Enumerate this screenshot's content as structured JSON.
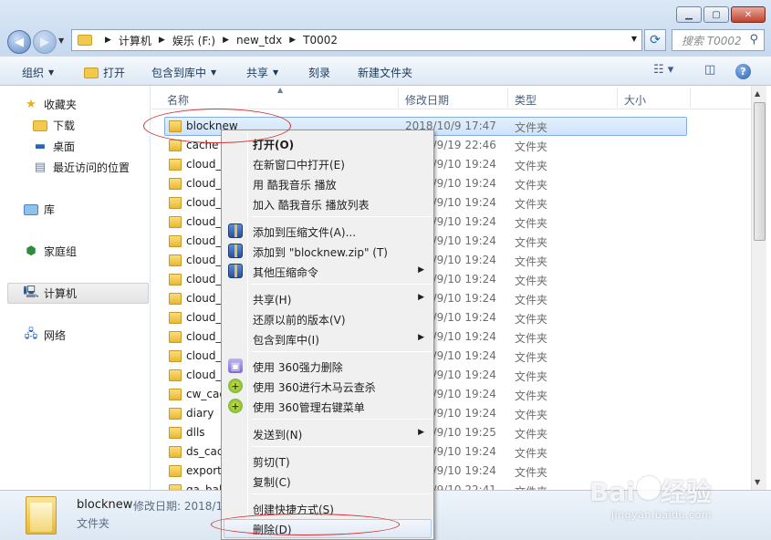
{
  "window": {
    "minimize_icon": "minimize-icon",
    "maximize_icon": "maximize-icon",
    "close_icon": "close-icon"
  },
  "address": {
    "crumbs": [
      "计算机",
      "娱乐 (F:)",
      "new_tdx",
      "T0002"
    ]
  },
  "search": {
    "placeholder": "搜索 T0002"
  },
  "toolbar": {
    "organize": "组织",
    "open": "打开",
    "include_in_library": "包含到库中",
    "share": "共享",
    "burn": "刻录",
    "new_folder": "新建文件夹"
  },
  "nav": {
    "favorites": "收藏夹",
    "downloads": "下载",
    "desktop": "桌面",
    "recent": "最近访问的位置",
    "libraries": "库",
    "homegroup": "家庭组",
    "computer": "计算机",
    "network": "网络"
  },
  "columns": {
    "name": "名称",
    "date": "修改日期",
    "type": "类型",
    "size": "大小"
  },
  "files": [
    {
      "name": "blocknew",
      "date": "2018/10/9 17:47",
      "type": "文件夹"
    },
    {
      "name": "cache",
      "date": "2018/9/19 22:46",
      "type": "文件夹"
    },
    {
      "name": "cloud_",
      "date": "2018/9/10 19:24",
      "type": "文件夹"
    },
    {
      "name": "cloud_",
      "date": "2018/9/10 19:24",
      "type": "文件夹"
    },
    {
      "name": "cloud_",
      "date": "2018/9/10 19:24",
      "type": "文件夹"
    },
    {
      "name": "cloud_",
      "date": "2018/9/10 19:24",
      "type": "文件夹"
    },
    {
      "name": "cloud_",
      "date": "2018/9/10 19:24",
      "type": "文件夹"
    },
    {
      "name": "cloud_",
      "date": "2018/9/10 19:24",
      "type": "文件夹"
    },
    {
      "name": "cloud_",
      "date": "2018/9/10 19:24",
      "type": "文件夹"
    },
    {
      "name": "cloud_",
      "date": "2018/9/10 19:24",
      "type": "文件夹"
    },
    {
      "name": "cloud_",
      "date": "2018/9/10 19:24",
      "type": "文件夹"
    },
    {
      "name": "cloud_",
      "date": "2018/9/10 19:24",
      "type": "文件夹"
    },
    {
      "name": "cloud_",
      "date": "2018/9/10 19:24",
      "type": "文件夹"
    },
    {
      "name": "cloud_",
      "date": "2018/9/10 19:24",
      "type": "文件夹"
    },
    {
      "name": "cw_cac",
      "date": "2018/9/10 19:24",
      "type": "文件夹"
    },
    {
      "name": "diary",
      "date": "2018/9/10 19:24",
      "type": "文件夹"
    },
    {
      "name": "dlls",
      "date": "2018/9/10 19:25",
      "type": "文件夹"
    },
    {
      "name": "ds_cac",
      "date": "2018/9/10 19:24",
      "type": "文件夹"
    },
    {
      "name": "export",
      "date": "2018/9/10 19:24",
      "type": "文件夹"
    },
    {
      "name": "ga_bak",
      "date": "2018/9/10 22:41",
      "type": "文件夹"
    }
  ],
  "details": {
    "name": "blocknew",
    "modified": "修改日期: 2018/1",
    "type": "文件夹"
  },
  "context_menu": {
    "open": "打开(O)",
    "open_new_window": "在新窗口中打开(E)",
    "play_kuwo": "用 酷我音乐 播放",
    "add_kuwo_list": "加入 酷我音乐 播放列表",
    "add_archive": "添加到压缩文件(A)...",
    "add_zip": "添加到 \"blocknew.zip\" (T)",
    "other_compress": "其他压缩命令",
    "share": "共享(H)",
    "restore_prev": "还原以前的版本(V)",
    "include_library": "包含到库中(I)",
    "del_360": "使用 360强力删除",
    "scan_360": "使用 360进行木马云查杀",
    "menu_360": "使用 360管理右键菜单",
    "send_to": "发送到(N)",
    "cut": "剪切(T)",
    "copy": "复制(C)",
    "shortcut": "创建快捷方式(S)",
    "delete": "删除(D)"
  },
  "watermark": {
    "logo": "Bai",
    "text": "经验",
    "url": "jingyan.baidu.com"
  },
  "colors": {
    "accent": "#2a5fae",
    "annotation": "#d43030",
    "selection": "#cde3fa"
  }
}
